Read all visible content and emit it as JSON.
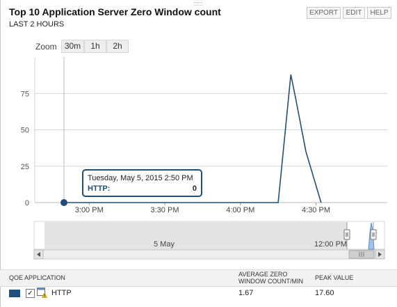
{
  "header": {
    "title": "Top 10 Application Server Zero Window count",
    "subtitle": "LAST 2 HOURS",
    "buttons": [
      "EXPORT",
      "EDIT",
      "HELP"
    ]
  },
  "zoom": {
    "label": "Zoom",
    "options": [
      "30m",
      "1h",
      "2h"
    ]
  },
  "chart_data": {
    "type": "line",
    "title": "",
    "xlabel": "",
    "ylabel": "",
    "y_ticks": [
      0,
      25,
      50,
      75
    ],
    "ylim": [
      0,
      100
    ],
    "x_ticks": [
      "3:00 PM",
      "3:30 PM",
      "4:00 PM",
      "4:30 PM"
    ],
    "x_range": [
      "2:50 PM",
      "4:50 PM"
    ],
    "grid": true,
    "series": [
      {
        "name": "HTTP",
        "color": "#1f4e79",
        "x": [
          "2:50 PM",
          "4:15 PM",
          "4:20 PM",
          "4:22 PM",
          "4:26 PM",
          "4:32 PM"
        ],
        "y": [
          0,
          0,
          88,
          71,
          35,
          0
        ]
      }
    ]
  },
  "tooltip": {
    "date": "Tuesday, May 5, 2015 2:50 PM",
    "series": "HTTP:",
    "value": "0"
  },
  "navigator": {
    "labels": [
      "5 May",
      "12:00 PM"
    ]
  },
  "legend": {
    "col_app": "QOE APPLICATION",
    "col_avg_line1": "AVERAGE ZERO",
    "col_avg_line2": "WINDOW COUNT/MIN",
    "col_peak": "PEAK VALUE",
    "rows": [
      {
        "app": "HTTP",
        "avg": "1.67",
        "peak": "17.60",
        "checked": true,
        "color": "#1f4e79"
      }
    ]
  }
}
